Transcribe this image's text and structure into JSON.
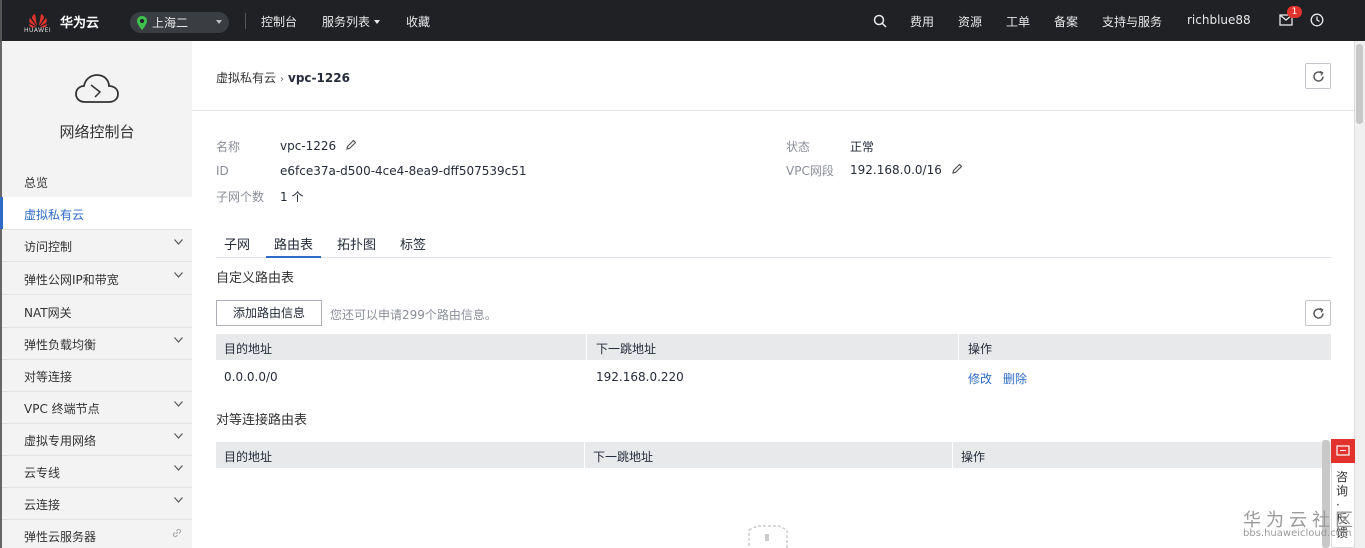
{
  "topbar": {
    "logo_text": "HUAWEI",
    "brand": "华为云",
    "region": "上海二",
    "nav": [
      "控制台",
      "服务列表",
      "收藏"
    ],
    "right_items": [
      "费用",
      "资源",
      "工单",
      "备案",
      "支持与服务",
      "richblue88"
    ],
    "message_count": "1",
    "colors": {
      "bar": "#1f2125",
      "badge": "#e2322d"
    }
  },
  "sidebar": {
    "title": "网络控制台",
    "items": [
      {
        "label": "总览"
      },
      {
        "label": "虚拟私有云"
      },
      {
        "label": "访问控制"
      },
      {
        "label": "弹性公网IP和带宽"
      },
      {
        "label": "NAT网关"
      },
      {
        "label": "弹性负载均衡"
      },
      {
        "label": "对等连接"
      },
      {
        "label": "VPC 终端节点"
      },
      {
        "label": "虚拟专用网络"
      },
      {
        "label": "云专线"
      },
      {
        "label": "云连接"
      },
      {
        "label": "弹性云服务器"
      }
    ]
  },
  "breadcrumb": {
    "parent": "虚拟私有云",
    "current": "vpc-1226"
  },
  "details": {
    "name_label": "名称",
    "name_value": "vpc-1226",
    "id_label": "ID",
    "id_value": "e6fce37a-d500-4ce4-8ea9-dff507539c51",
    "subnets_label": "子网个数",
    "subnets_value": "1 个",
    "status_label": "状态",
    "status_value": "正常",
    "cidr_label": "VPC网段",
    "cidr_value": "192.168.0.0/16"
  },
  "tabs": [
    "子网",
    "路由表",
    "拓扑图",
    "标签"
  ],
  "custom_routes": {
    "title": "自定义路由表",
    "add_button": "添加路由信息",
    "hint": "您还可以申请299个路由信息。",
    "columns": [
      "目的地址",
      "下一跳地址",
      "操作"
    ],
    "rows": [
      {
        "dest": "0.0.0.0/0",
        "next_hop": "192.168.0.220",
        "actions": [
          "修改",
          "删除"
        ]
      }
    ]
  },
  "peering_routes": {
    "title": "对等连接路由表",
    "columns": [
      "目的地址",
      "下一跳地址",
      "操作"
    ]
  },
  "feedback": {
    "label": "咨询·反馈"
  },
  "watermark": {
    "title": "华为云社区",
    "url": "bbs.huaweicloud.com"
  },
  "accent_color": "#2e6bc6"
}
